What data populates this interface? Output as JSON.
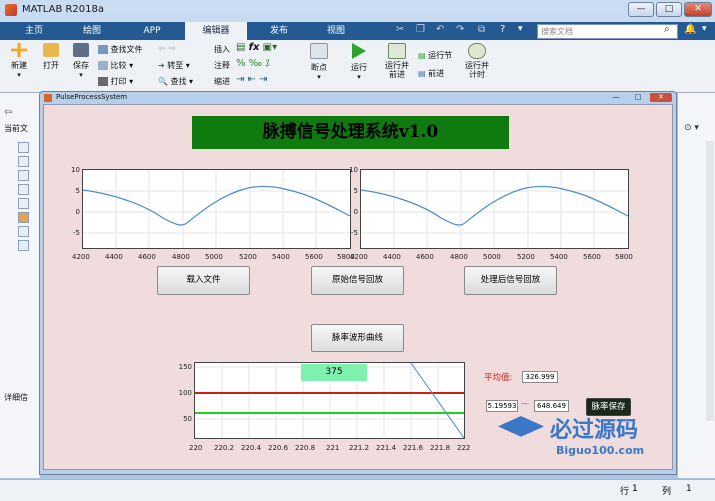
{
  "app": {
    "title": "MATLAB R2018a"
  },
  "tabs": [
    {
      "label": "主页"
    },
    {
      "label": "绘图"
    },
    {
      "label": "APP"
    },
    {
      "label": "编辑器"
    },
    {
      "label": "发布"
    },
    {
      "label": "视图"
    }
  ],
  "search": {
    "placeholder": "搜索文档"
  },
  "ribbon": {
    "new": "新建",
    "open": "打开",
    "save": "保存",
    "find_files": "查找文件",
    "compare": "比较",
    "print": "打印",
    "goto": "转至",
    "find": "查找",
    "insert": "插入",
    "comment": "注释",
    "indent": "缩进",
    "fx": "fx",
    "breakpoints": "断点",
    "run": "运行",
    "run_advance": "运行并\n前进",
    "run_section": "运行节",
    "advance": "前进",
    "run_time": "运行并\n计时"
  },
  "left_panel": {
    "current_folder": "当前文",
    "details": "详细信"
  },
  "status": {
    "row_label": "行",
    "row": "1",
    "col_label": "列",
    "col": "1"
  },
  "figure": {
    "title": "PulseProcessSystem",
    "headline": "脉搏信号处理系统v1.0",
    "plot1": {
      "yticks": [
        "10",
        "5",
        "0",
        "-5"
      ],
      "xticks": [
        "4200",
        "4400",
        "4600",
        "4800",
        "5000",
        "5200",
        "5400",
        "5600",
        "5800"
      ]
    },
    "plot2": {
      "yticks": [
        "10",
        "5",
        "0",
        "-5"
      ],
      "xticks": [
        "4200",
        "4400",
        "4600",
        "4800",
        "5000",
        "5200",
        "5400",
        "5600",
        "5800"
      ]
    },
    "plot3": {
      "yticks": [
        "150",
        "100",
        "50"
      ],
      "xticks": [
        "220",
        "220.2",
        "220.4",
        "220.6",
        "220.8",
        "221",
        "221.2",
        "221.4",
        "221.6",
        "221.8",
        "222"
      ],
      "value_box": "375"
    },
    "buttons": {
      "load": "载入文件",
      "play_original": "原始信号回放",
      "play_processed": "处理后信号回放",
      "pulse_wave": "脉率波形曲线",
      "save_rate": "脉率保存"
    },
    "average_label": "平均值:",
    "average_value": "326.999",
    "range_low": "5.19593",
    "range_sep": "—",
    "range_high": "648.649"
  },
  "watermark": {
    "line1": "必过源码",
    "line2": "Biguo100.com"
  },
  "colors": {
    "signal": "#4a8ccc",
    "red_line": "#cc1f1f",
    "green_line": "#1fd41f",
    "headline_bg": "#0f7b0f"
  }
}
